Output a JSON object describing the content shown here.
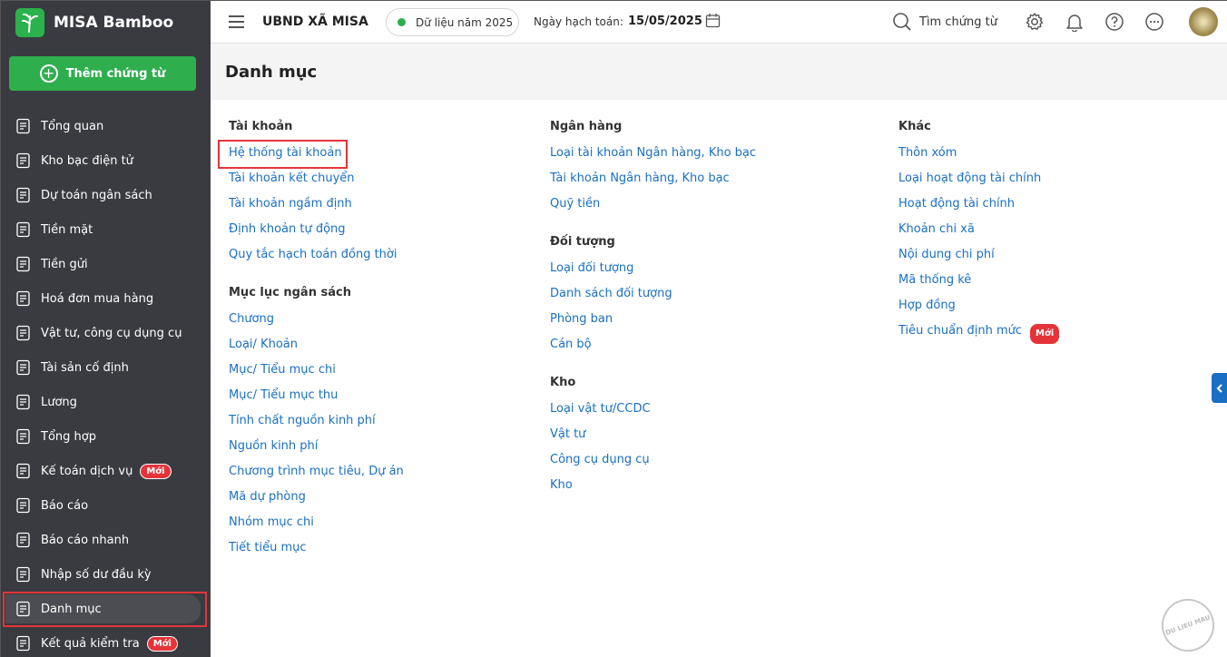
{
  "app": {
    "name": "MISA Bamboo",
    "add_label": "Thêm chứng từ"
  },
  "sidebar": {
    "items": [
      {
        "label": "Tổng quan",
        "icon": "pie-chart-icon"
      },
      {
        "label": "Kho bạc điện tử",
        "icon": "monitor-icon"
      },
      {
        "label": "Dự toán ngân sách",
        "icon": "budget-icon"
      },
      {
        "label": "Tiền mặt",
        "icon": "cash-icon"
      },
      {
        "label": "Tiền gửi",
        "icon": "deposit-icon"
      },
      {
        "label": "Hoá đơn mua hàng",
        "icon": "invoice-icon"
      },
      {
        "label": "Vật tư, công cụ dụng cụ",
        "icon": "tools-icon"
      },
      {
        "label": "Tài sản cố định",
        "icon": "bank-icon"
      },
      {
        "label": "Lương",
        "icon": "salary-icon"
      },
      {
        "label": "Tổng hợp",
        "icon": "summary-icon"
      },
      {
        "label": "Kế toán dịch vụ",
        "icon": "service-icon",
        "badge": "Mới"
      },
      {
        "label": "Báo cáo",
        "icon": "report-icon"
      },
      {
        "label": "Báo cáo nhanh",
        "icon": "quick-report-icon"
      },
      {
        "label": "Nhập số dư đầu kỳ",
        "icon": "opening-balance-icon"
      },
      {
        "label": "Danh mục",
        "icon": "catalog-icon",
        "active": true
      },
      {
        "label": "Kết quả kiểm tra",
        "icon": "check-result-icon",
        "badge": "Mới"
      }
    ]
  },
  "topbar": {
    "org": "UBND XÃ MISA",
    "year": "Dữ liệu năm 2025",
    "date_label": "Ngày hạch toán:",
    "date_value": "15/05/2025",
    "search": "Tìm chứng từ"
  },
  "page": {
    "title": "Danh mục"
  },
  "columns": [
    {
      "groups": [
        {
          "title": "Tài khoản",
          "links": [
            "Hệ thống tài khoản",
            "Tài khoản kết chuyển",
            "Tài khoản ngầm định",
            "Định khoản tự động",
            "Quy tắc hạch toán đồng thời"
          ]
        },
        {
          "title": "Mục lục ngân sách",
          "links": [
            "Chương",
            "Loại/ Khoản",
            "Mục/ Tiểu mục chi",
            "Mục/ Tiểu mục thu",
            "Tính chất nguồn kinh phí",
            "Nguồn kinh phí",
            "Chương trình mục tiêu, Dự án",
            "Mã dự phòng",
            "Nhóm mục chi",
            "Tiết tiểu mục"
          ]
        }
      ]
    },
    {
      "groups": [
        {
          "title": "Ngân hàng",
          "links": [
            "Loại tài khoản Ngân hàng, Kho bạc",
            "Tài khoản Ngân hàng, Kho bạc",
            "Quỹ tiền"
          ]
        },
        {
          "title": "Đối tượng",
          "links": [
            "Loại đối tượng",
            "Danh sách đối tượng",
            "Phòng ban",
            "Cán bộ"
          ]
        },
        {
          "title": "Kho",
          "links": [
            "Loại vật tư/CCDC",
            "Vật tư",
            "Công cụ dụng cụ",
            "Kho"
          ]
        }
      ]
    },
    {
      "groups": [
        {
          "title": "Khác",
          "links": [
            "Thôn xóm",
            "Loại hoạt động tài chính",
            "Hoạt động tài chính",
            "Khoản chi xã",
            "Nội dung chi phí",
            "Mã thống kê",
            "Hợp đồng",
            "Tiêu chuẩn định mức"
          ],
          "badge_on_last": "Mới"
        }
      ]
    }
  ],
  "stamp": "DU LIEU MAU",
  "colors": {
    "sidebar": "#3a3b40",
    "accent": "#2fae4e",
    "link": "#1a6fc4",
    "highlight": "#e4343a"
  }
}
